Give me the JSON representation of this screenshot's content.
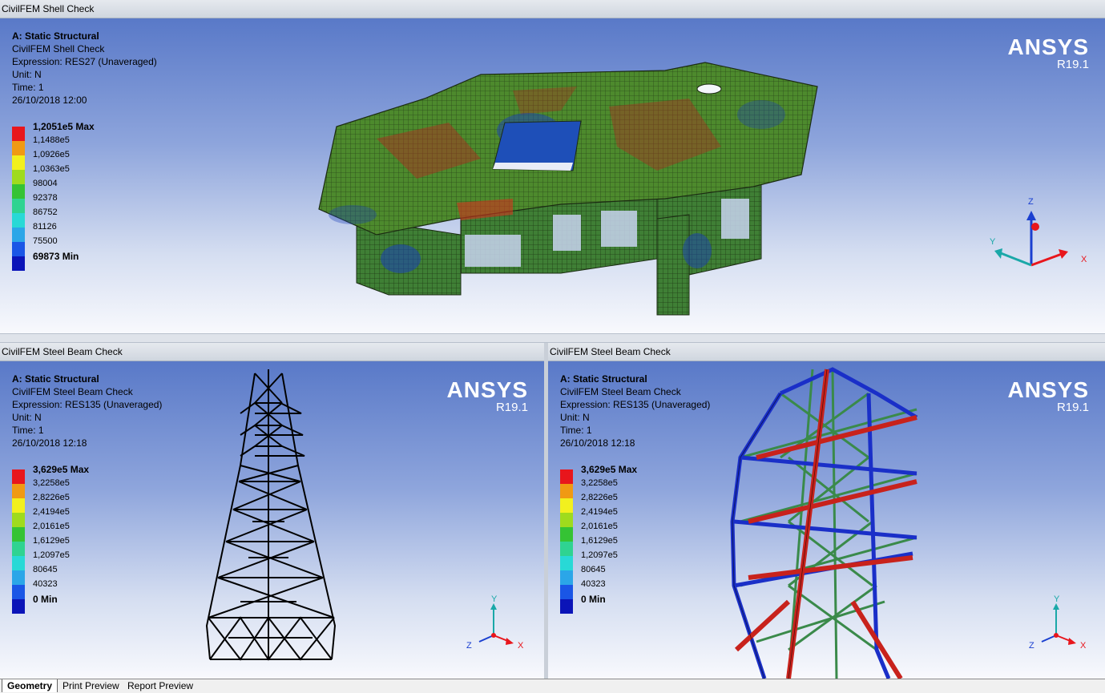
{
  "top": {
    "title": "CivilFEM Shell Check",
    "info": {
      "analysis": "A: Static Structural",
      "result": "CivilFEM Shell Check",
      "expression": "Expression: RES27 (Unaveraged)",
      "unit": "Unit: N",
      "time": "Time: 1",
      "date": "26/10/2018 12:00"
    },
    "legend": [
      "1,2051e5 Max",
      "1,1488e5",
      "1,0926e5",
      "1,0363e5",
      "98004",
      "92378",
      "86752",
      "81126",
      "75500",
      "69873 Min"
    ],
    "brand": "ANSYS",
    "version": "R19.1",
    "axes": {
      "z": "Z",
      "y": "Y",
      "x": "X"
    }
  },
  "bottom_left": {
    "title": "CivilFEM Steel Beam Check",
    "info": {
      "analysis": "A: Static Structural",
      "result": "CivilFEM Steel Beam Check",
      "expression": "Expression: RES135 (Unaveraged)",
      "unit": "Unit: N",
      "time": "Time: 1",
      "date": "26/10/2018 12:18"
    },
    "legend": [
      "3,629e5 Max",
      "3,2258e5",
      "2,8226e5",
      "2,4194e5",
      "2,0161e5",
      "1,6129e5",
      "1,2097e5",
      "80645",
      "40323",
      "0 Min"
    ],
    "brand": "ANSYS",
    "version": "R19.1",
    "axes": {
      "y": "Y",
      "z": "Z",
      "x": "X"
    }
  },
  "bottom_right": {
    "title": "CivilFEM Steel Beam Check",
    "info": {
      "analysis": "A: Static Structural",
      "result": "CivilFEM Steel Beam Check",
      "expression": "Expression: RES135 (Unaveraged)",
      "unit": "Unit: N",
      "time": "Time: 1",
      "date": "26/10/2018 12:18"
    },
    "legend": [
      "3,629e5 Max",
      "3,2258e5",
      "2,8226e5",
      "2,4194e5",
      "2,0161e5",
      "1,6129e5",
      "1,2097e5",
      "80645",
      "40323",
      "0 Min"
    ],
    "brand": "ANSYS",
    "version": "R19.1",
    "axes": {
      "y": "Y",
      "z": "Z",
      "x": "X"
    }
  },
  "legend_colors": [
    "#e8161c",
    "#f09a13",
    "#f2f01e",
    "#9fdb1d",
    "#35c334",
    "#2fd391",
    "#28d9d6",
    "#2ba6e8",
    "#1a56e6",
    "#0b14b8"
  ],
  "tabs": [
    "Geometry",
    "Print Preview",
    "Report Preview"
  ]
}
